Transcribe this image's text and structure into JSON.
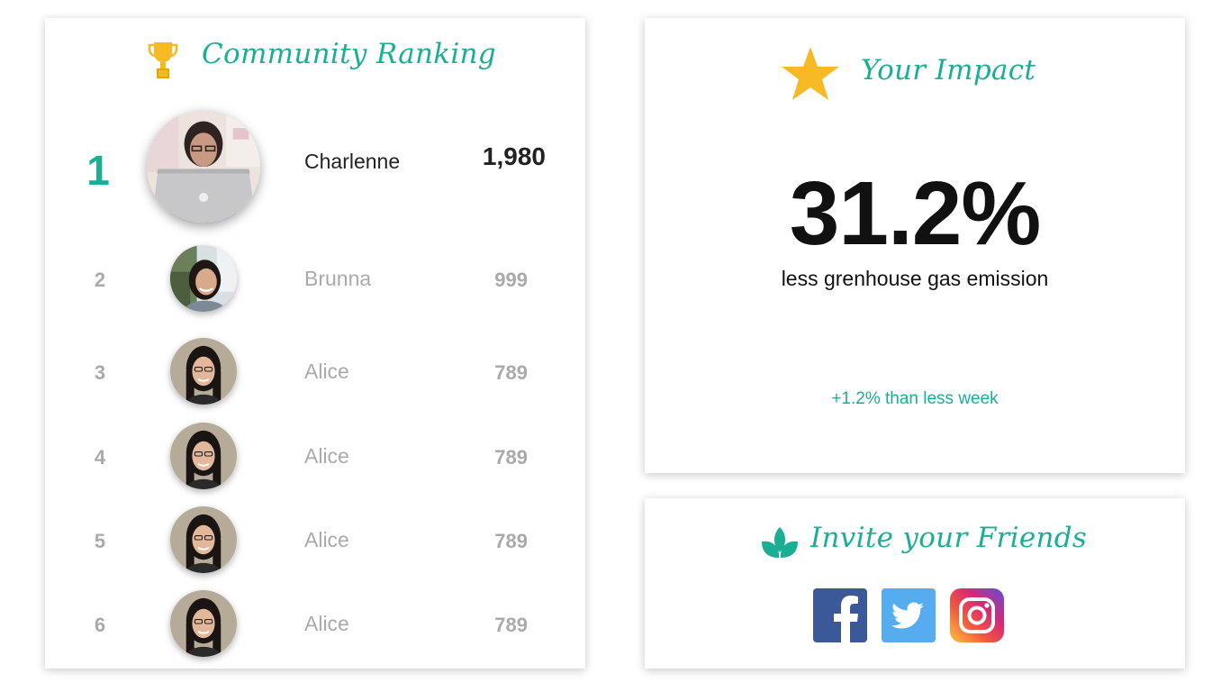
{
  "ranking": {
    "title": "Community Ranking",
    "icon": "trophy-icon",
    "entries": [
      {
        "rank": "1",
        "name": "Charlenne",
        "score": "1,980"
      },
      {
        "rank": "2",
        "name": "Brunna",
        "score": "999"
      },
      {
        "rank": "3",
        "name": "Alice",
        "score": "789"
      },
      {
        "rank": "4",
        "name": "Alice",
        "score": "789"
      },
      {
        "rank": "5",
        "name": "Alice",
        "score": "789"
      },
      {
        "rank": "6",
        "name": "Alice",
        "score": "789"
      }
    ]
  },
  "impact": {
    "title": "Your Impact",
    "icon": "star-icon",
    "value": "31.2%",
    "caption": "less grenhouse gas emission",
    "change": "+1.2% than less week"
  },
  "invite": {
    "title": "Invite your Friends",
    "icon": "leaf-icon",
    "social": [
      "facebook-icon",
      "twitter-icon",
      "instagram-icon"
    ]
  },
  "colors": {
    "accent": "#1aae95",
    "gold": "#f7b924",
    "muted_text": "#aaaaaa",
    "primary_text": "#222222",
    "facebook": "#3b5998",
    "twitter": "#55acee"
  }
}
